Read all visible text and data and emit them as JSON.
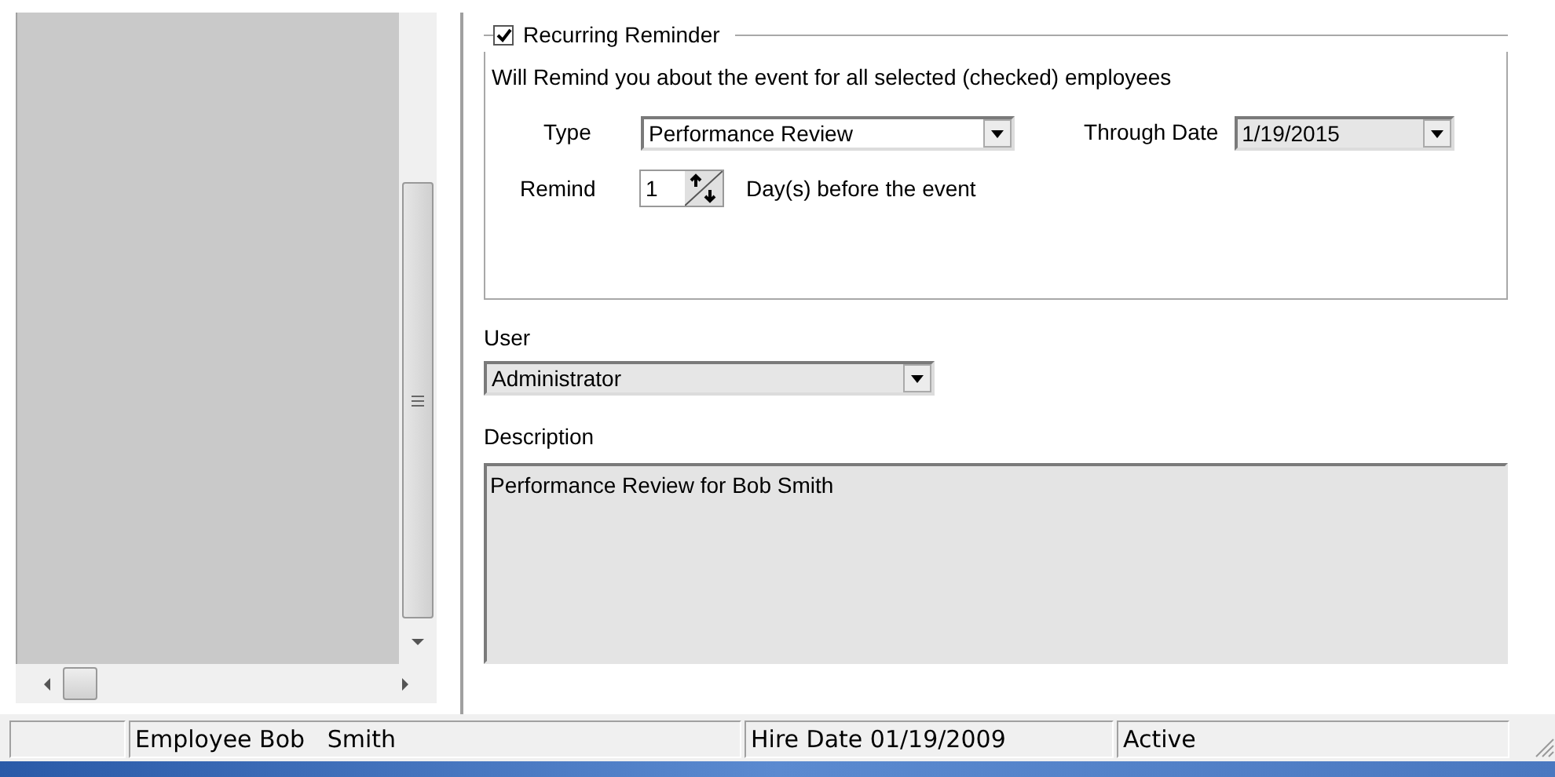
{
  "reminder": {
    "label": "Recurring Reminder",
    "checked": true,
    "note": "Will Remind you about the event for all selected (checked) employees",
    "type_label": "Type",
    "type_value": "Performance Review",
    "through_label": "Through Date",
    "through_value": "1/19/2015",
    "remind_label": "Remind",
    "remind_value": "1",
    "remind_suffix": "Day(s) before the event"
  },
  "user": {
    "label": "User",
    "value": "Administrator"
  },
  "description": {
    "label": "Description",
    "value": "Performance Review for Bob Smith"
  },
  "status_bar": [
    "Employee Bob   Smith",
    "Hire Date 01/19/2009",
    "Active"
  ]
}
